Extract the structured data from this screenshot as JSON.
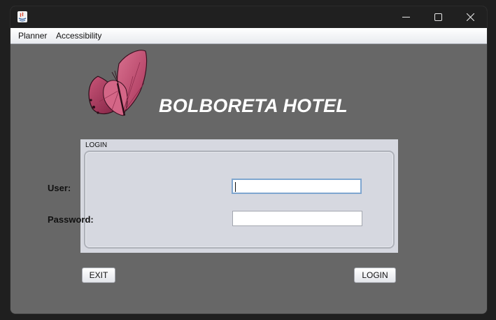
{
  "window": {
    "controls": {
      "minimize": "─",
      "maximize": "☐",
      "close": "✕"
    }
  },
  "menu": {
    "items": [
      "Planner",
      "Accessibility"
    ]
  },
  "header": {
    "title": "BOLBORETA HOTEL",
    "logo": "butterfly-logo"
  },
  "login_panel": {
    "title": "LOGIN",
    "user_label": "User:",
    "user_value": "",
    "password_label": "Password:",
    "password_value": ""
  },
  "buttons": {
    "exit": "EXIT",
    "login": "LOGIN"
  },
  "colors": {
    "window_bg": "#676767",
    "titlebar": "#202020",
    "panel_bg": "#d6d8e0",
    "logo_pink": "#c9557a"
  }
}
